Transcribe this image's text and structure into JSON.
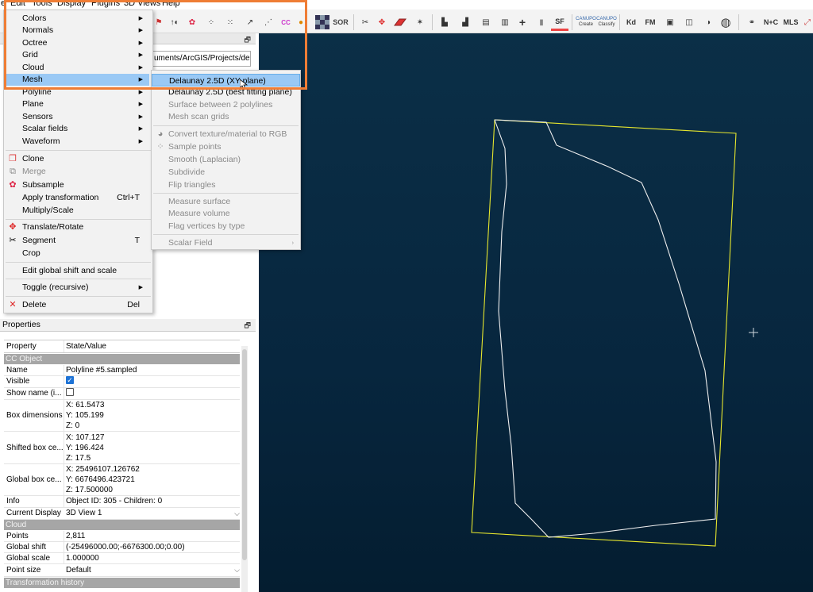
{
  "menubar": [
    "e",
    "Edit",
    "Tools",
    "Display",
    "Plugins",
    "3D Views",
    "Help"
  ],
  "toolbar": {
    "sor_label": "SOR",
    "sf_label": "SF",
    "create_label": "Create",
    "classify_label": "Classify",
    "kd_label": "Kd",
    "fm_label": "FM",
    "mls_label": "MLS",
    "nc_label": "N+C"
  },
  "db_tree": {
    "path": "uments/ArcGIS/Projects/de..."
  },
  "edit_menu": [
    {
      "label": "Colors",
      "submenu": true,
      "icon": ""
    },
    {
      "label": "Normals",
      "submenu": true,
      "icon": ""
    },
    {
      "label": "Octree",
      "submenu": true,
      "icon": ""
    },
    {
      "label": "Grid",
      "submenu": true,
      "icon": ""
    },
    {
      "label": "Cloud",
      "submenu": true,
      "icon": ""
    },
    {
      "label": "Mesh",
      "submenu": true,
      "icon": "",
      "highlighted": true
    },
    {
      "label": "Polyline",
      "submenu": true,
      "icon": ""
    },
    {
      "label": "Plane",
      "submenu": true,
      "icon": ""
    },
    {
      "label": "Sensors",
      "submenu": true,
      "icon": ""
    },
    {
      "label": "Scalar fields",
      "submenu": true,
      "icon": ""
    },
    {
      "label": "Waveform",
      "submenu": true,
      "icon": ""
    },
    {
      "label": "Clone",
      "submenu": false,
      "icon": "clone-icon"
    },
    {
      "label": "Merge",
      "submenu": false,
      "icon": "merge-icon",
      "disabled": true
    },
    {
      "label": "Subsample",
      "submenu": false,
      "icon": "subsample-icon"
    },
    {
      "label": "Apply transformation",
      "submenu": false,
      "icon": "",
      "shortcut": "Ctrl+T"
    },
    {
      "label": "Multiply/Scale",
      "submenu": false,
      "icon": ""
    },
    {
      "label": "Translate/Rotate",
      "submenu": false,
      "icon": "translate-rotate-icon"
    },
    {
      "label": "Segment",
      "submenu": false,
      "icon": "segment-icon",
      "shortcut": "T"
    },
    {
      "label": "Crop",
      "submenu": false,
      "icon": ""
    },
    {
      "label": "Edit global shift and scale",
      "submenu": false,
      "icon": ""
    },
    {
      "label": "Toggle (recursive)",
      "submenu": true,
      "icon": ""
    },
    {
      "label": "Delete",
      "submenu": false,
      "icon": "delete-icon",
      "shortcut": "Del"
    }
  ],
  "mesh_menu": [
    {
      "label": "Delaunay 2.5D (XY plane)",
      "highlighted": true
    },
    {
      "label": "Delaunay 2.5D (best fitting plane)"
    },
    {
      "label": "Surface between 2 polylines",
      "disabled": true
    },
    {
      "label": "Mesh scan grids",
      "disabled": true
    },
    {
      "label": "Convert texture/material to RGB",
      "disabled": true,
      "icon": "convert-texture-icon"
    },
    {
      "label": "Sample points",
      "disabled": true,
      "icon": "sample-points-icon"
    },
    {
      "label": "Smooth (Laplacian)",
      "disabled": true
    },
    {
      "label": "Subdivide",
      "disabled": true
    },
    {
      "label": "Flip triangles",
      "disabled": true
    },
    {
      "label": "Measure surface",
      "disabled": true
    },
    {
      "label": "Measure volume",
      "disabled": true
    },
    {
      "label": "Flag vertices by type",
      "disabled": true
    },
    {
      "label": "Scalar Field",
      "disabled": true,
      "submenu": true
    }
  ],
  "properties": {
    "title": "Properties",
    "header": {
      "property": "Property",
      "value": "State/Value"
    },
    "sections": {
      "cc_object": "CC Object",
      "cloud": "Cloud",
      "transformation_history": "Transformation history"
    },
    "name": {
      "label": "Name",
      "value": "Polyline #5.sampled"
    },
    "visible": {
      "label": "Visible",
      "checked": true
    },
    "show_name": {
      "label": "Show name (i...",
      "checked": false
    },
    "box_dimensions": {
      "label": "Box dimensions",
      "lines": [
        "X: 61.5473",
        "Y: 105.199",
        "Z: 0"
      ]
    },
    "shifted_box_center": {
      "label": "Shifted box ce...",
      "lines": [
        "X: 107.127",
        "Y: 196.424",
        "Z: 17.5"
      ]
    },
    "global_box_center": {
      "label": "Global box ce...",
      "lines": [
        "X: 25496107.126762",
        "Y: 6676496.423721",
        "Z: 17.500000"
      ]
    },
    "info": {
      "label": "Info",
      "value": "Object ID: 305 - Children: 0"
    },
    "current_display": {
      "label": "Current Display",
      "value": "3D View 1"
    },
    "points": {
      "label": "Points",
      "value": "2,811"
    },
    "global_shift": {
      "label": "Global shift",
      "value": "(-25496000.00;-6676300.00;0.00)"
    },
    "global_scale": {
      "label": "Global scale",
      "value": "1.000000"
    },
    "point_size": {
      "label": "Point size",
      "value": "Default"
    }
  },
  "colors": {
    "bbox": "#e6e62e",
    "polyline": "#f0f0f0",
    "highlight_border": "#ef7d35",
    "menu_highlight": "#9ac9f5"
  }
}
